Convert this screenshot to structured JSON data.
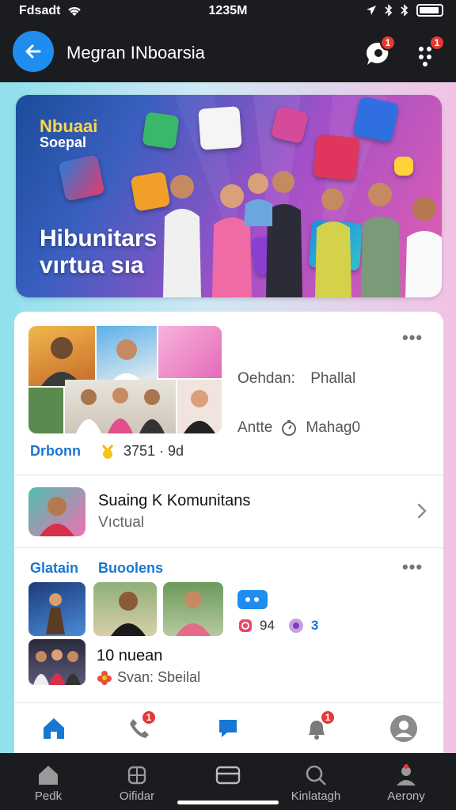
{
  "status_bar": {
    "carrier": "Fdsadt",
    "time": "1235M"
  },
  "header": {
    "title": "Megran INboarsia",
    "notif_badge": "1",
    "menu_badge": "1"
  },
  "banner": {
    "logo_line1": "Nbuaai",
    "logo_line2": "Soepal",
    "headline_line1": "Hibunitars",
    "headline_line2": "vırtua sıa"
  },
  "feature_card": {
    "meta1_label": "Oehdan:",
    "meta1_value": "Phallal",
    "meta2_label": "Antte",
    "meta2_value": "Mahag0",
    "stat_name": "Drbonn",
    "stat_value": "3751 · 9d"
  },
  "community": {
    "title": "Suaing K Komunitans",
    "subtitle": "Vıctual"
  },
  "section": {
    "tab1": "Glatain",
    "tab2": "Buoolens",
    "reaction_count1": "94",
    "reaction_count2": "3",
    "post_title": "10 nuean",
    "post_subtitle": "Svan: Sbeilal"
  },
  "tabbar": {
    "calls_badge": "1",
    "alerts_badge": "1"
  },
  "system_nav": {
    "items": [
      "Pedk",
      "Oifidar",
      "",
      "Kinlatagh",
      "Aerony"
    ]
  },
  "colors": {
    "accent_blue": "#1f8df0",
    "badge_red": "#e53935",
    "dark_bar": "#1b1c20"
  }
}
